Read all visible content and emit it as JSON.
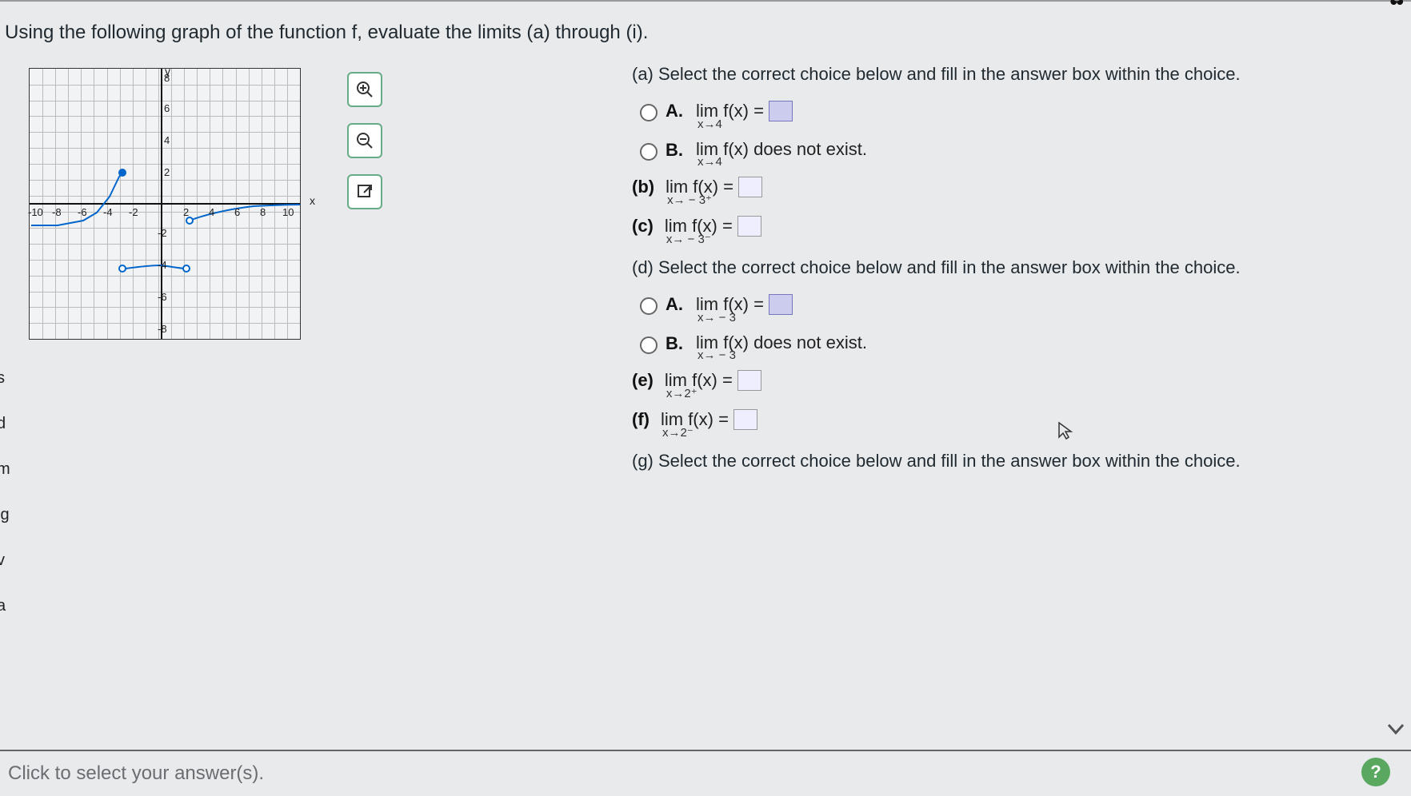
{
  "prompt_text": "Using the following graph of the function f, evaluate the limits (a) through (i).",
  "axis_labels": {
    "x": "x",
    "y": "y"
  },
  "x_ticks": [
    "-10",
    "-8",
    "-6",
    "-4",
    "-2",
    "2",
    "4",
    "6",
    "8",
    "10"
  ],
  "y_ticks_pos": [
    "2",
    "4",
    "6",
    "8"
  ],
  "y_ticks_neg": [
    "-2",
    "-4",
    "-6",
    "-8"
  ],
  "chart_data": {
    "type": "line",
    "xlim": [
      -10.5,
      10.5
    ],
    "ylim": [
      -8.5,
      8.5
    ],
    "grid": true,
    "series": [
      {
        "name": "left-branch",
        "segments": [
          {
            "from_x": -10,
            "to_x": -3,
            "approx_points": [
              [
                -10,
                -1.3
              ],
              [
                -8,
                -1.3
              ],
              [
                -6,
                -1
              ],
              [
                -5,
                -0.5
              ],
              [
                -4,
                0.5
              ],
              [
                -3.1,
                2
              ]
            ]
          }
        ],
        "endpoints": [
          {
            "x": -3,
            "y": 2,
            "open": false
          }
        ]
      },
      {
        "name": "right-branch",
        "segments": [
          {
            "from_x": -3,
            "to_x": 2,
            "approx_points": [
              [
                -2.9,
                -4
              ],
              [
                -1.5,
                -3.8
              ],
              [
                -0.5,
                -3.6
              ],
              [
                0,
                -3.6
              ],
              [
                1,
                -3.7
              ],
              [
                2,
                -4
              ]
            ]
          },
          {
            "from_x": 2,
            "to_x": 10,
            "approx_points": [
              [
                2.1,
                -1
              ],
              [
                3,
                -0.7
              ],
              [
                4,
                -0.4
              ],
              [
                6,
                -0.1
              ],
              [
                8,
                0
              ],
              [
                10,
                0
              ]
            ]
          }
        ],
        "endpoints": [
          {
            "x": -3,
            "y": -4,
            "open": true
          },
          {
            "x": 2,
            "y": -4,
            "open": true
          },
          {
            "x": 2,
            "y": -1,
            "open": true
          }
        ]
      }
    ],
    "title": "",
    "xlabel": "x",
    "ylabel": "y"
  },
  "parts": {
    "a": {
      "prompt": "(a) Select the correct choice below and fill in the answer box within the choice.",
      "A": {
        "label": "A.",
        "lim_top": "lim  f(x) =",
        "lim_sub": "x→4"
      },
      "B": {
        "label": "B.",
        "lim_top": "lim  f(x) does not exist.",
        "lim_sub": "x→4"
      }
    },
    "b": {
      "label": "(b)",
      "lim_top": "lim    f(x) =",
      "lim_sub": "x→ − 3⁺"
    },
    "c": {
      "label": "(c)",
      "lim_top": "lim    f(x) =",
      "lim_sub": "x→ − 3⁻"
    },
    "d": {
      "prompt": "(d) Select the correct choice below and fill in the answer box within the choice.",
      "A": {
        "label": "A.",
        "lim_top": "lim   f(x) =",
        "lim_sub": "x→ − 3"
      },
      "B": {
        "label": "B.",
        "lim_top": "lim   f(x) does not exist.",
        "lim_sub": "x→ − 3"
      }
    },
    "e": {
      "label": "(e)",
      "lim_top": "lim   f(x) =",
      "lim_sub": "x→2⁺"
    },
    "f": {
      "label": "(f)",
      "lim_top": "lim   f(x) =",
      "lim_sub": "x→2⁻"
    },
    "g_prompt": "(g) Select the correct choice below and fill in the answer box within the choice."
  },
  "footer_text": "Click to select your answer(s).",
  "help_label": "?",
  "tools": {
    "zoom_in": "zoom-in",
    "zoom_out": "zoom-out",
    "open_ext": "open-external"
  }
}
